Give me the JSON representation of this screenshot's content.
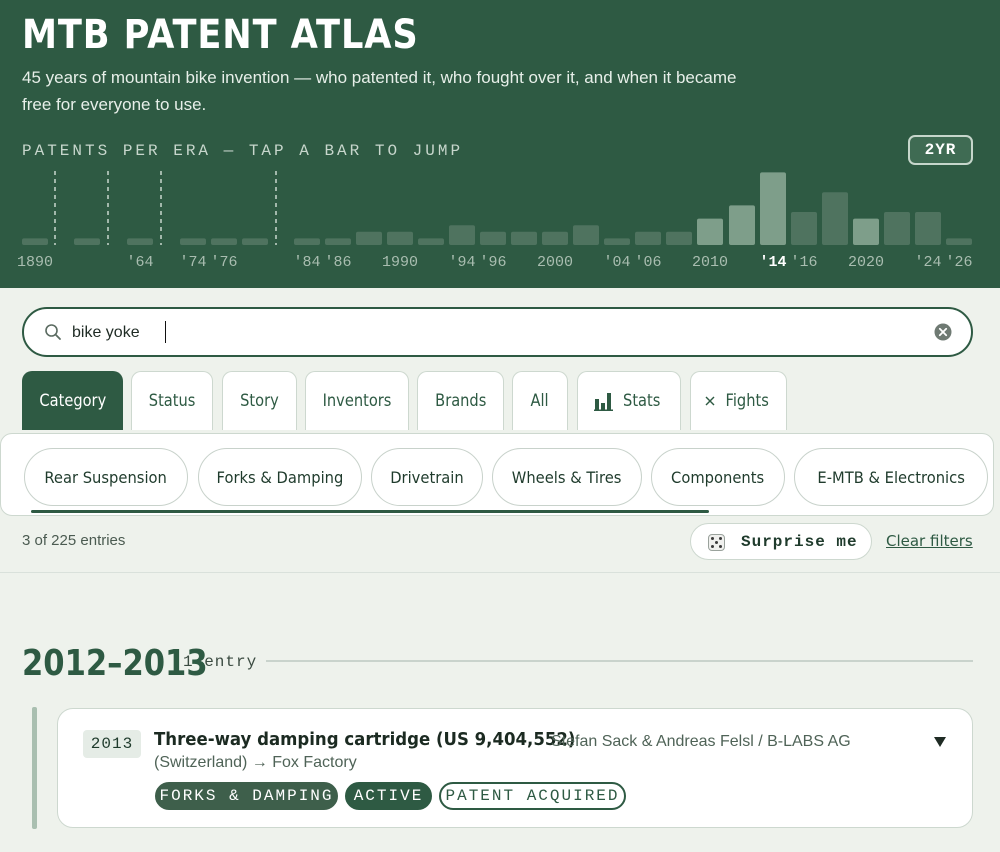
{
  "header": {
    "title": "MTB PATENT ATLAS",
    "subtitle": "45 years of mountain bike invention — who patented it, who fought over it, and when it became free for everyone to use.",
    "chart_label": "PATENTS PER ERA — TAP A BAR TO JUMP",
    "toggle_label": "2YR"
  },
  "chart_data": {
    "type": "bar",
    "title": "PATENTS PER ERA — TAP A BAR TO JUMP",
    "tick_labels": [
      "1890",
      "'64",
      "'74",
      "'76",
      "'84",
      "'86",
      "1990",
      "'94",
      "'96",
      "2000",
      "'04",
      "'06",
      "2010",
      "'14",
      "'16",
      "2020",
      "'24",
      "'26"
    ],
    "values": [
      1,
      1,
      1,
      1,
      1,
      1,
      1,
      1,
      2,
      2,
      1,
      3,
      2,
      2,
      2,
      3,
      1,
      2,
      2,
      4,
      6,
      11,
      5,
      8,
      4,
      5,
      5,
      1
    ],
    "highlighted_indices": [
      19,
      20,
      21,
      24
    ],
    "selected_tick": "'14"
  },
  "search": {
    "value": "bike yoke",
    "placeholder": ""
  },
  "tabs": [
    {
      "label": "Category",
      "active": true
    },
    {
      "label": "Status"
    },
    {
      "label": "Story"
    },
    {
      "label": "Inventors"
    },
    {
      "label": "Brands"
    },
    {
      "label": "All"
    },
    {
      "label": "Stats",
      "icon": "bar-chart-icon"
    },
    {
      "label": "Fights",
      "icon": "crossed-swords-icon"
    }
  ],
  "chips": [
    "Rear Suspension",
    "Forks & Damping",
    "Drivetrain",
    "Wheels & Tires",
    "Components",
    "E-MTB & Electronics"
  ],
  "filter_bar": {
    "entry_count": "3 of 225 entries",
    "surprise_label": "Surprise me",
    "clear_label": "Clear filters"
  },
  "era": {
    "title": "2012–2013",
    "count": "1 entry"
  },
  "entry": {
    "year": "2013",
    "title": "Three-way damping cartridge (US 9,404,552)",
    "people_line1": "Stefan Sack & Andreas Felsl / B-LABS AG",
    "people_line2": "(Switzerland) → Fox Factory",
    "tags": [
      "FORKS & DAMPING",
      "ACTIVE",
      "PATENT ACQUIRED"
    ]
  },
  "colors": {
    "header_bg": "#2e5a43",
    "accent": "#2e5a43",
    "page_bg": "#eef2ec"
  }
}
